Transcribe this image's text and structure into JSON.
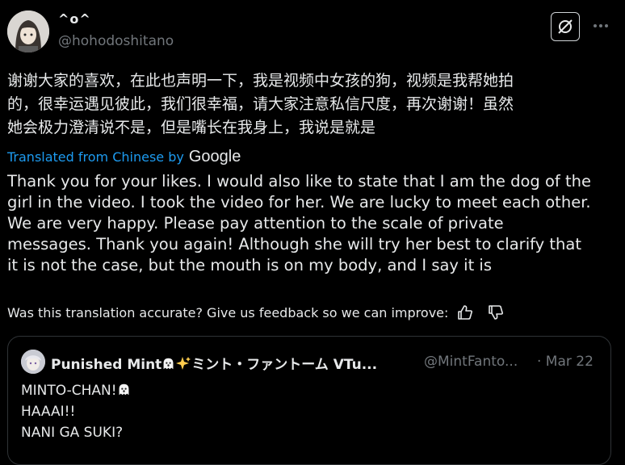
{
  "author": {
    "display_name": "^o^",
    "handle": "@hohodoshitano"
  },
  "icons": {
    "grok": "grok-icon",
    "more": "more-icon",
    "thumbs_up": "thumbs-up-icon",
    "thumbs_down": "thumbs-down-icon",
    "ghost": "ghost-icon",
    "sparkles": "sparkles-icon"
  },
  "post": {
    "original_lines": [
      "谢谢大家的喜欢，在此也声明一下，我是视频中女孩的狗，视频是我帮她拍",
      "的，很幸运遇见彼此，我们很幸福，请大家注意私信尺度，再次谢谢！虽然",
      "她会极力澄清说不是，但是嘴长在我身上，我说是就是"
    ],
    "translated_from": "Translated from Chinese by",
    "translator": "Google",
    "translation_lines": [
      "Thank you for your likes. I would also like to state that I am the dog of the",
      "girl in the video. I took the video for her. We are lucky to meet each other.",
      "We are very happy. Please pay attention to the scale of private",
      "messages. Thank you again! Although she will try her best to clarify that",
      "it is not the case, but the mouth is on my body, and I say it is"
    ],
    "feedback_prompt": "Was this translation accurate? Give us feedback so we can improve:"
  },
  "quote": {
    "name_part1": "Punished Mint",
    "name_part2": "ミント・ファントーム VTu...",
    "handle": "@MintFanto...",
    "date": "· Mar 22",
    "line1": "MINTO-CHAN!",
    "line2": "HAAAI!!",
    "line3": "NANI GA SUKI?"
  },
  "colors": {
    "background": "#000000",
    "text": "#e7e9ea",
    "muted": "#71767b",
    "link": "#1d9bf0",
    "border": "#2f3336"
  }
}
